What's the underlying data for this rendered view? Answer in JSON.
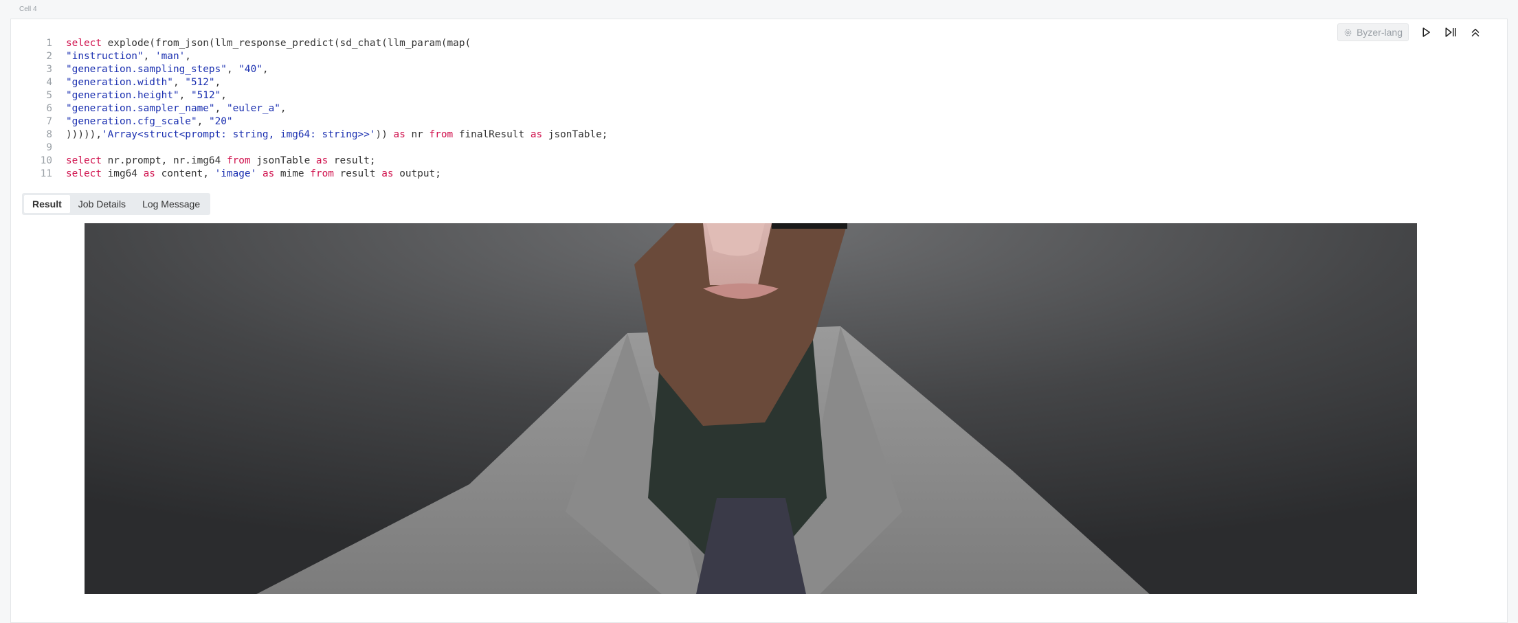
{
  "cell": {
    "label": "Cell 4"
  },
  "toolbar": {
    "language": "Byzer-lang",
    "run_icon": "play-icon",
    "run_next_icon": "play-pause-icon",
    "collapse_icon": "collapse-up-icon"
  },
  "code": {
    "lines": [
      {
        "n": "1",
        "text": "select explode(from_json(llm_response_predict(sd_chat(llm_param(map("
      },
      {
        "n": "2",
        "text": "\"instruction\", 'man',"
      },
      {
        "n": "3",
        "text": "\"generation.sampling_steps\", \"40\","
      },
      {
        "n": "4",
        "text": "\"generation.width\", \"512\","
      },
      {
        "n": "5",
        "text": "\"generation.height\", \"512\","
      },
      {
        "n": "6",
        "text": "\"generation.sampler_name\", \"euler_a\","
      },
      {
        "n": "7",
        "text": "\"generation.cfg_scale\", \"20\""
      },
      {
        "n": "8",
        "text": "))))),'Array<struct<prompt: string, img64: string>>')) as nr from finalResult as jsonTable;"
      },
      {
        "n": "9",
        "text": ""
      },
      {
        "n": "10",
        "text": "select nr.prompt, nr.img64 from jsonTable as result;"
      },
      {
        "n": "11",
        "text": "select img64 as content, 'image' as mime from result as output;"
      }
    ]
  },
  "tabs": [
    {
      "label": "Result",
      "active": true
    },
    {
      "label": "Job Details",
      "active": false
    },
    {
      "label": "Log Message",
      "active": false
    }
  ],
  "result": {
    "image_alt": "generated portrait of a bearded man in a gray suit"
  }
}
